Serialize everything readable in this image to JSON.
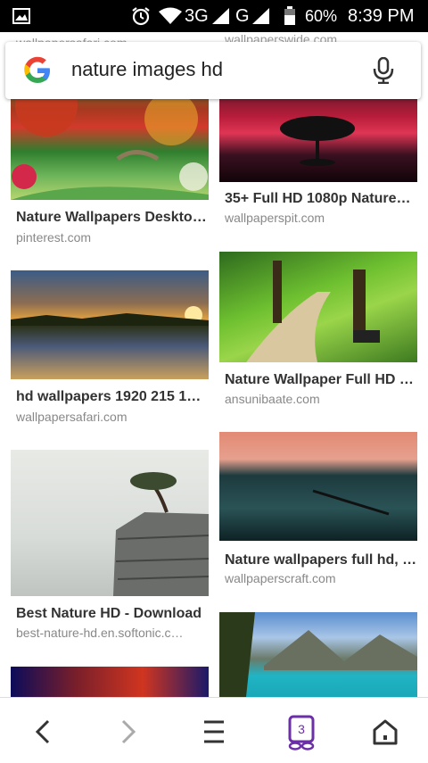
{
  "status": {
    "network": "3G",
    "network2": "G",
    "battery": "60%",
    "time": "8:39 PM"
  },
  "search": {
    "query": "nature images hd"
  },
  "peek": {
    "left_source": "wallpapersafari.com",
    "right_source": "wallpaperswide.com"
  },
  "results": [
    {
      "title": "Nature Wallpapers Deskto…",
      "source": "pinterest.com"
    },
    {
      "title": "35+ Full HD 1080p Nature…",
      "source": "wallpaperspit.com"
    },
    {
      "title": "hd wallpapers 1920 215 1…",
      "source": "wallpapersafari.com"
    },
    {
      "title": "Nature Wallpaper Full HD …",
      "source": "ansunibaate.com"
    },
    {
      "title": "Best Nature HD - Download",
      "source": "best-nature-hd.en.softonic.c…"
    },
    {
      "title": "Nature wallpapers full hd, …",
      "source": "wallpaperscraft.com"
    }
  ],
  "nav": {
    "tabs_count": "3"
  },
  "icons": [
    "image-icon",
    "alarm-icon",
    "wifi-icon",
    "signal-icon",
    "battery-icon",
    "google-logo-icon",
    "mic-icon",
    "back-icon",
    "forward-icon",
    "menu-icon",
    "tabs-icon",
    "home-icon"
  ]
}
